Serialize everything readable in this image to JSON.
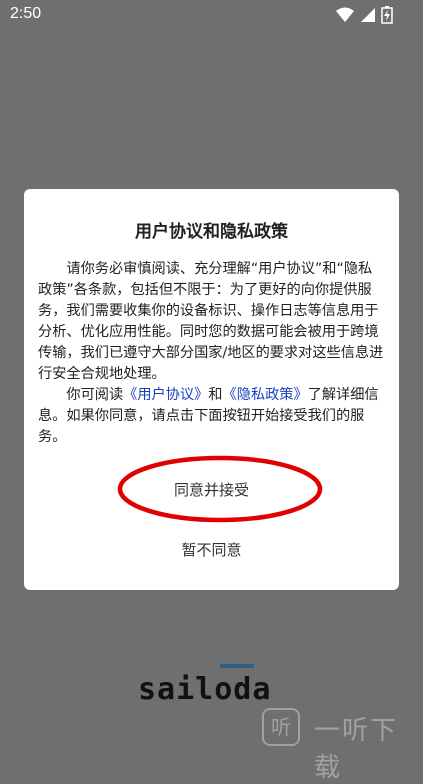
{
  "status_bar": {
    "time": "2:50",
    "icons": [
      "wifi-icon",
      "signal-icon",
      "battery-icon"
    ]
  },
  "dialog": {
    "title": "用户协议和隐私政策",
    "paragraph1": "请你务必审慎阅读、充分理解“用户协议”和“隐私政策”各条款，包括但不限于：为了更好的向你提供服务，我们需要收集你的设备标识、操作日志等信息用于分析、优化应用性能。同时您的数据可能会被用于跨境传输，我们已遵守大部分国家/地区的要求对这些信息进行安全合规地处理。",
    "paragraph2_prefix": "你可阅读",
    "user_agreement_link": "《用户协议》",
    "and_text": "和",
    "privacy_policy_link": "《隐私政策》",
    "paragraph2_suffix": "了解详细信息。如果你同意，请点击下面按钮开始接受我们的服务。",
    "agree_button": "同意并接受",
    "disagree_button": "暂不同意"
  },
  "annotation": {
    "color": "#e00000"
  },
  "logo": {
    "text": "sailoda"
  },
  "watermark": {
    "text": "一听下载",
    "glyph": "听"
  },
  "colors": {
    "overlay_background": "#6f6f6f",
    "dialog_background": "#ffffff",
    "link": "#1a3fc6"
  }
}
